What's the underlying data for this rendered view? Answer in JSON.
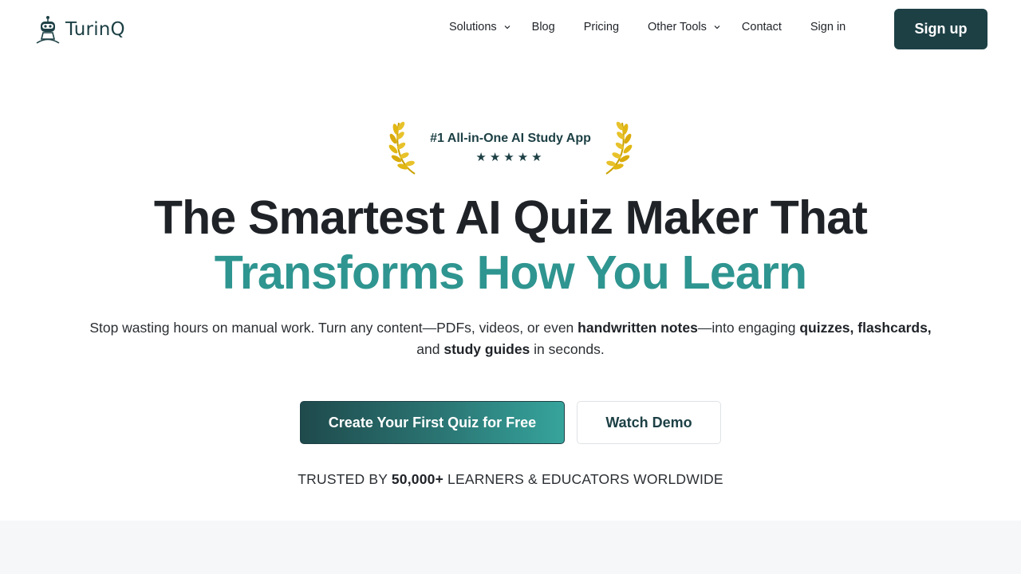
{
  "brand": {
    "name": "TurinQ",
    "logo_icon": "robot-logo-icon",
    "color": "#1d4045",
    "accent": "#2f9590"
  },
  "nav": {
    "items": [
      {
        "label": "Solutions",
        "dropdown": true
      },
      {
        "label": "Blog",
        "dropdown": false
      },
      {
        "label": "Pricing",
        "dropdown": false
      },
      {
        "label": "Other Tools",
        "dropdown": true
      },
      {
        "label": "Contact",
        "dropdown": false
      },
      {
        "label": "Sign in",
        "dropdown": false
      }
    ],
    "signup_label": "Sign up"
  },
  "badge": {
    "text": "#1 All-in-One AI Study App",
    "stars": "★★★★★",
    "rating": 5,
    "icon": "laurel-icon"
  },
  "hero": {
    "title_line1": "The Smartest AI Quiz Maker That",
    "title_line2": "Transforms How You Learn",
    "subtitle": {
      "p1": "Stop wasting hours on manual work. Turn any content—PDFs, videos, or even ",
      "b1": "handwritten notes",
      "p2": "—into engaging ",
      "b2": "quizzes, flashcards,",
      "p3": " and ",
      "b3": "study guides",
      "p4": " in seconds."
    },
    "cta_primary": "Create Your First Quiz for Free",
    "cta_secondary": "Watch Demo"
  },
  "trust": {
    "prefix": "TRUSTED BY ",
    "count": "50,000+",
    "suffix": " LEARNERS & EDUCATORS WORLDWIDE"
  }
}
